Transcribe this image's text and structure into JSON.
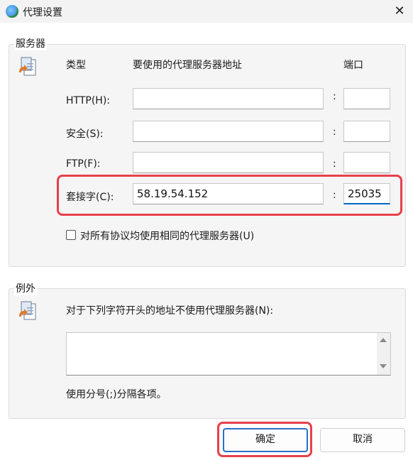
{
  "window": {
    "title": "代理设置",
    "close_glyph": "✕"
  },
  "servers": {
    "group_label": "服务器",
    "col_type": "类型",
    "col_address": "要使用的代理服务器地址",
    "col_port": "端口",
    "rows": [
      {
        "label": "HTTP(H):",
        "address": "",
        "port": ""
      },
      {
        "label": "安全(S):",
        "address": "",
        "port": ""
      },
      {
        "label": "FTP(F):",
        "address": "",
        "port": ""
      },
      {
        "label": "套接字(C):",
        "address": "58.19.54.152",
        "port": "25035"
      }
    ],
    "colon": ":",
    "same_proxy_label": "对所有协议均使用相同的代理服务器(U)",
    "same_proxy_checked": false
  },
  "exceptions": {
    "group_label": "例外",
    "description": "对于下列字符开头的地址不使用代理服务器(N):",
    "value": "",
    "hint": "使用分号(;)分隔各项。"
  },
  "buttons": {
    "ok": "确定",
    "cancel": "取消"
  },
  "colors": {
    "highlight": "#e8404b",
    "accent": "#0067c0"
  },
  "icons": {
    "window": "globe-icon",
    "server": "document-arrow-icon",
    "exceptions": "document-arrow-icon"
  }
}
